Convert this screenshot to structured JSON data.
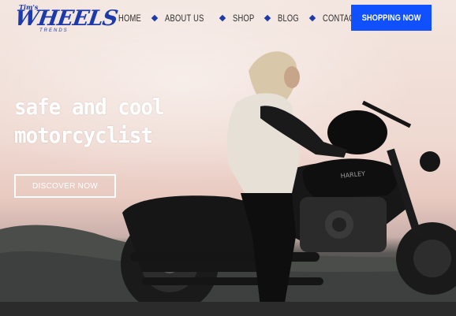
{
  "brand": {
    "logo_top": "Tim's",
    "logo_main": "WHEELS",
    "logo_sub": "TRENDS",
    "color": "#1c3aa9"
  },
  "nav": {
    "items": [
      "HOME",
      "ABOUT US",
      "SHOP",
      "BLOG",
      "CONTACT"
    ],
    "separator_color": "#1c3aa9"
  },
  "cta": {
    "shop_label": "SHOPPING NOW",
    "color": "#1150ff"
  },
  "hero": {
    "headline_line1": "safe and cool",
    "headline_line2": "motorcyclist",
    "discover_label": "DISCOVER NOW",
    "image_icon": "woman-on-motorcycle-photo"
  }
}
